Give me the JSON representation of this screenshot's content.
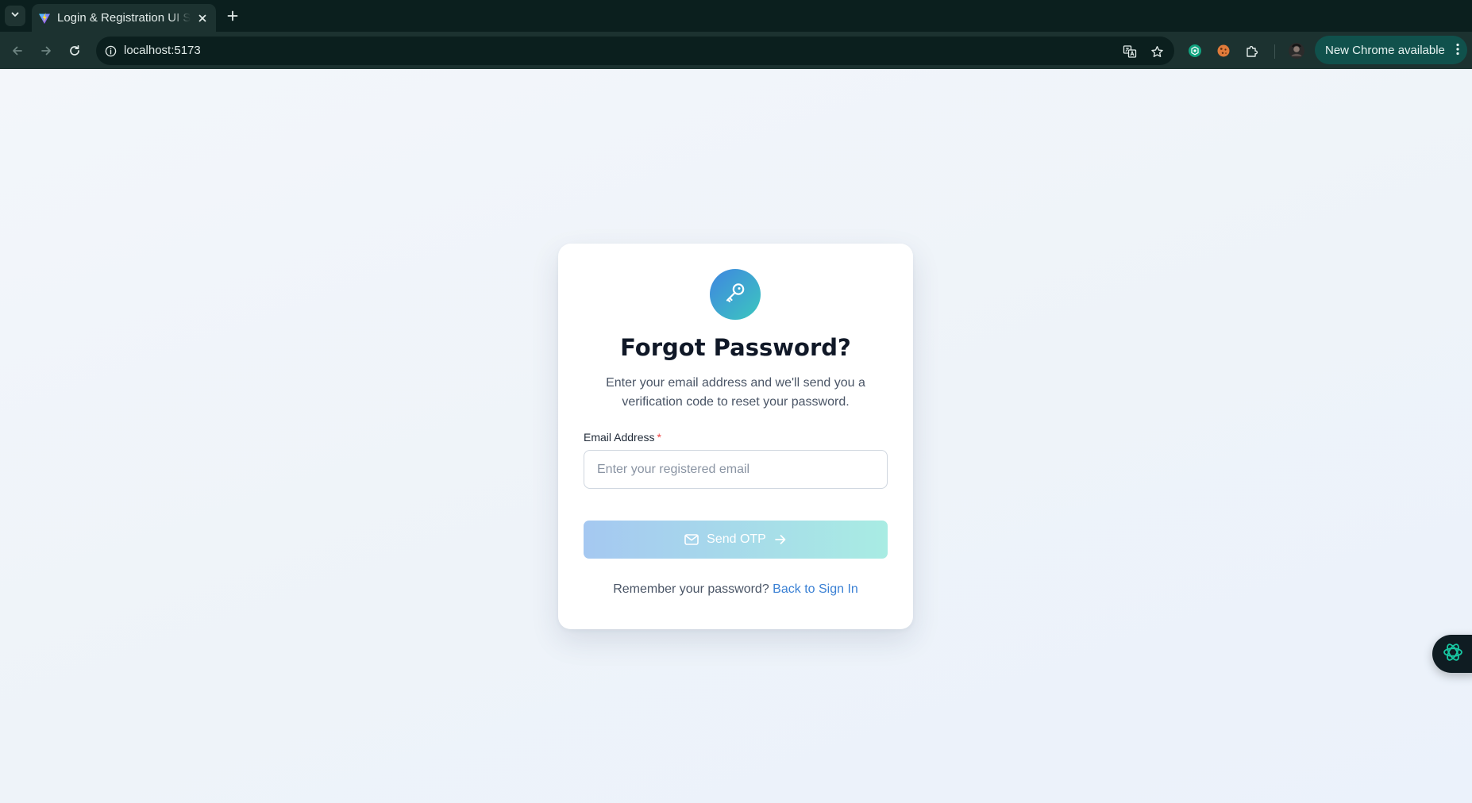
{
  "browser": {
    "tab_title": "Login & Registration UI S",
    "url": "localhost:5173",
    "update_chip_label": "New Chrome available",
    "icons": [
      "tab-search-icon",
      "vite-favicon",
      "close-icon",
      "plus-icon",
      "back-arrow-icon",
      "forward-arrow-icon",
      "reload-icon",
      "site-info-icon",
      "translate-icon",
      "star-icon",
      "chatgpt-extension-icon",
      "cookie-extension-icon",
      "extensions-puzzle-icon",
      "profile-avatar",
      "kebab-menu-icon"
    ]
  },
  "card": {
    "icon": "key-icon",
    "title": "Forgot Password?",
    "subtitle": "Enter your email address and we'll send you a verification code to reset your password.",
    "email_label": "Email Address",
    "required_mark": "*",
    "email_placeholder": "Enter your registered email",
    "email_value": "",
    "send_button_label": "Send OTP",
    "send_button_icons": [
      "mail-icon",
      "arrow-right-icon"
    ],
    "footer_text": "Remember your password?",
    "footer_link": "Back to Sign In"
  },
  "colors": {
    "accent_link": "#3a80d4",
    "badge_gradient": [
      "#3f86e0",
      "#3cc7bf"
    ],
    "button_gradient": [
      "#a5c8f1",
      "#a8ece3"
    ],
    "required": "#ef4444"
  },
  "floating_widget": {
    "icon": "openai-assistant-icon"
  }
}
